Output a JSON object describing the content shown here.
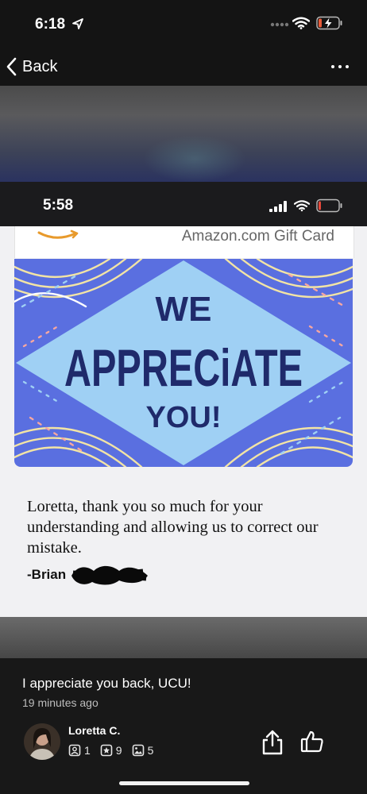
{
  "status_outer": {
    "time": "6:18"
  },
  "nav": {
    "back_label": "Back"
  },
  "inner_screenshot": {
    "time": "5:58",
    "gift_card_title": "Amazon.com Gift Card",
    "card_art": {
      "line1": "WE",
      "line2": "APPRECiATE",
      "line3": "YOU!"
    },
    "message": "Loretta, thank you so much for your understanding and allowing us to correct our mistake.",
    "signature": "-Brian"
  },
  "post": {
    "caption": "I appreciate you back, UCU!",
    "timestamp": "19 minutes ago",
    "author": "Loretta C.",
    "stats": {
      "reviews": "1",
      "stars": "9",
      "photos": "5"
    }
  },
  "icons": [
    "location-arrow-icon",
    "cellular-dots-icon",
    "wifi-icon",
    "battery-charging-icon",
    "chevron-left-icon",
    "more-icon",
    "amazon-smile-logo",
    "share-icon",
    "thumbs-up-icon",
    "review-icon",
    "star-icon",
    "photo-icon"
  ],
  "colors": {
    "card_blue": "#5a6fe0",
    "card_light": "#9fd0f4",
    "card_text": "#1f2a6b",
    "battery_charge": "#e85b3a"
  }
}
